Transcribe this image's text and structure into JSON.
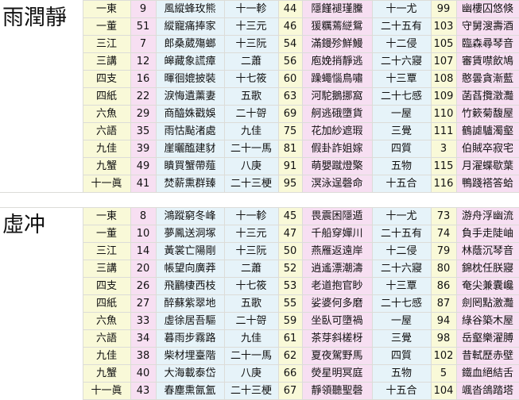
{
  "sections": [
    {
      "title": "雨潤靜",
      "rows": [
        [
          "一東",
          "9",
          "風縱蜂玫熊",
          "十一軫",
          "44",
          "隱饉褪瑾黱",
          "十一尤",
          "99",
          "幽樓囚悠倏"
        ],
        [
          "一董",
          "51",
          "縱寵痛捧家",
          "十三元",
          "46",
          "猨糲蔫縌鴛",
          "二十五有",
          "103",
          "守舅溲壽酒"
        ],
        [
          "三江",
          "7",
          "郎桑葳殤螂",
          "十三阮",
          "54",
          "滿鏝殄鮮鰻",
          "十二侵",
          "105",
          "臨森尋琴音"
        ],
        [
          "三講",
          "12",
          "皞藏象謊瘴",
          "二蕭",
          "56",
          "庖娩捎靜逃",
          "二十六寢",
          "107",
          "審賃噤飲鳩"
        ],
        [
          "四支",
          "16",
          "暉徊媲披裝",
          "十七筱",
          "60",
          "躁蠅惱鳥嘯",
          "十三覃",
          "108",
          "憨曇貪漸藍"
        ],
        [
          "四紙",
          "22",
          "淚悔遺薰妻",
          "五歌",
          "63",
          "河駝鵝挪窩",
          "二十七感",
          "109",
          "菡萏攬澂灩"
        ],
        [
          "六魚",
          "29",
          "商醯姝戳娛",
          "二十哿",
          "69",
          "舸逃硪墮貨",
          "一屋",
          "110",
          "竹簌菊馥屋"
        ],
        [
          "六語",
          "35",
          "雨怙颭渚處",
          "九佳",
          "75",
          "花加紗遮瑕",
          "三覺",
          "111",
          "鶴謔驢濁壑"
        ],
        [
          "九佳",
          "39",
          "崖曬醢建豺",
          "二十一馬",
          "81",
          "假卦詐姐嫁",
          "四質",
          "3",
          "伯賊卒寂宅"
        ],
        [
          "九蟹",
          "49",
          "瞶買蟹帶薤",
          "八庚",
          "91",
          "萌嬰蹴燈檠",
          "五物",
          "115",
          "月濯蝶歇葉"
        ],
        [
          "十一眞",
          "41",
          "焚薪熏群臻",
          "二十三梗",
          "95",
          "溟泳逞磬命",
          "十五合",
          "116",
          "鴨踐褡答蛤"
        ]
      ]
    },
    {
      "title": "虛冲",
      "rows": [
        [
          "一東",
          "8",
          "鴻蹤窮冬峰",
          "十一軫",
          "45",
          "畏震困隱遁",
          "十一尤",
          "73",
          "游舟浮幽流"
        ],
        [
          "一董",
          "10",
          "夢鳳送洞塚",
          "十三元",
          "47",
          "千船穿嬋川",
          "二十五有",
          "74",
          "負手走陡岫"
        ],
        [
          "三江",
          "14",
          "黃裳亡陽剛",
          "十三阮",
          "50",
          "燕雁返遠岸",
          "十二侵",
          "79",
          "林蔭沉琴音"
        ],
        [
          "三講",
          "20",
          "帳望向廣莽",
          "二蕭",
          "52",
          "逍遙漂潮濤",
          "二十六寢",
          "80",
          "錦枕任朕寢"
        ],
        [
          "四支",
          "26",
          "飛鸝棲西枝",
          "十七筱",
          "53",
          "老道抱官眇",
          "十三覃",
          "86",
          "奄尖兼囊巉"
        ],
        [
          "四紙",
          "27",
          "醉蘇紫翠地",
          "五歌",
          "55",
          "娑婆何多磨",
          "二十七感",
          "87",
          "劍罔點激灩"
        ],
        [
          "六魚",
          "33",
          "虛徐居吾驅",
          "二十哿",
          "59",
          "坐臥可墮禍",
          "一屋",
          "94",
          "綠谷築木屋"
        ],
        [
          "六語",
          "34",
          "暮雨步霧路",
          "九佳",
          "61",
          "茶芽斜槎枒",
          "三覺",
          "98",
          "岳壑樂濯膊"
        ],
        [
          "九佳",
          "38",
          "柴材埋臺階",
          "二十一馬",
          "62",
          "夏夜駕野馬",
          "四質",
          "102",
          "昔軾歷赤壁"
        ],
        [
          "九蟹",
          "40",
          "大海載泰岱",
          "八庚",
          "66",
          "熒星明冥庭",
          "五物",
          "5",
          "鐵血絕結舌"
        ],
        [
          "十一眞",
          "43",
          "春塵熏氤氳",
          "二十三梗",
          "67",
          "靜領聽聖磬",
          "十五合",
          "104",
          "颯沓鴿踏塔"
        ]
      ]
    }
  ]
}
